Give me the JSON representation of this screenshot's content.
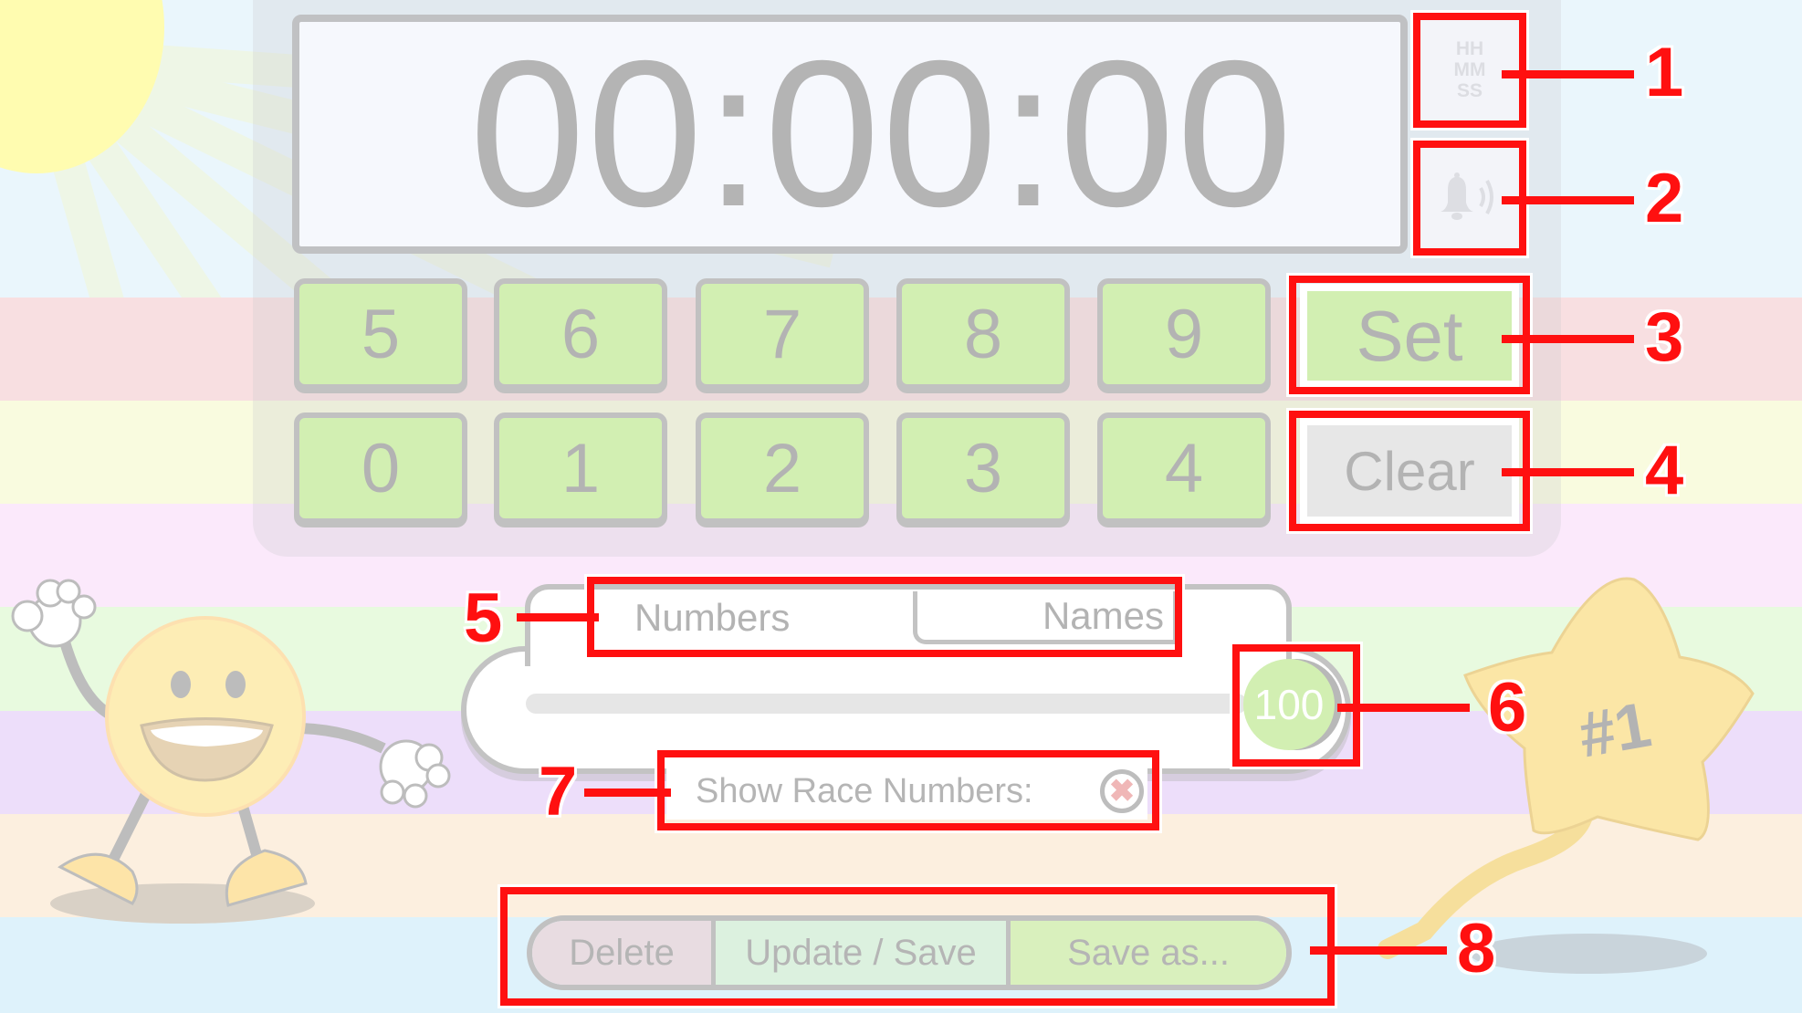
{
  "display": {
    "time": "00:00:00"
  },
  "side_buttons": {
    "format": {
      "icon": "hh-mm-ss-format-icon",
      "lines": [
        "HH",
        "MM",
        "SS"
      ]
    },
    "sound": {
      "icon": "bell-sound-icon"
    }
  },
  "keypad": {
    "row1": [
      "5",
      "6",
      "7",
      "8",
      "9"
    ],
    "row2": [
      "0",
      "1",
      "2",
      "3",
      "4"
    ],
    "set_label": "Set",
    "clear_label": "Clear"
  },
  "tabs": {
    "items": [
      {
        "label": "Numbers",
        "active": true
      },
      {
        "label": "Names",
        "active": false
      }
    ]
  },
  "slider": {
    "value": "100",
    "fraction": 1.0
  },
  "race_numbers": {
    "label": "Show Race Numbers:",
    "enabled": false,
    "toggle_glyph": "✖"
  },
  "actions": {
    "delete_label": "Delete",
    "update_label": "Update / Save",
    "save_as_label": "Save as..."
  },
  "callouts": [
    "1",
    "2",
    "3",
    "4",
    "5",
    "6",
    "7",
    "8"
  ],
  "decorations": {
    "star_balloon_text": "#1"
  },
  "colors": {
    "callout": "#ff1010",
    "key_green": "#d2efb2",
    "clear_grey": "#e7e7e7",
    "delete_pink": "#e8dce1",
    "update_mint": "#dcf1df",
    "save_as_green": "#d9f0bd"
  }
}
